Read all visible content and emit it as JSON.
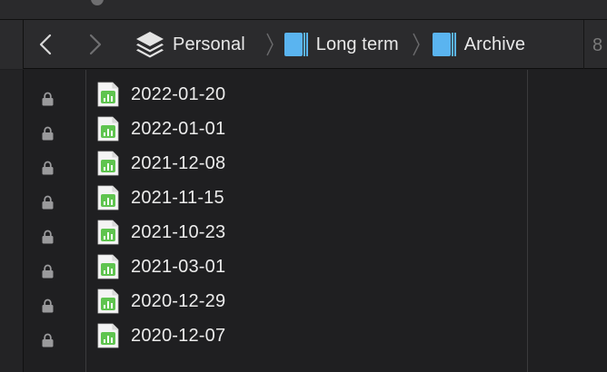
{
  "toolbar": {
    "breadcrumbs": [
      {
        "label": "Personal",
        "icon": "stack-icon"
      },
      {
        "label": "Long term",
        "icon": "folder-blue-icon"
      },
      {
        "label": "Archive",
        "icon": "folder-blue-icon"
      }
    ],
    "overflow_text": "8"
  },
  "files": [
    {
      "name": "2022-01-20",
      "locked": true
    },
    {
      "name": "2022-01-01",
      "locked": true
    },
    {
      "name": "2021-12-08",
      "locked": true
    },
    {
      "name": "2021-11-15",
      "locked": true
    },
    {
      "name": "2021-10-23",
      "locked": true
    },
    {
      "name": "2021-03-01",
      "locked": true
    },
    {
      "name": "2020-12-29",
      "locked": true
    },
    {
      "name": "2020-12-07",
      "locked": true
    }
  ],
  "colors": {
    "background": "#1f1f21",
    "toolbar": "#2b2b2d",
    "folder_blue": "#5ab4f0",
    "numbers_green": "#5fc44f"
  }
}
